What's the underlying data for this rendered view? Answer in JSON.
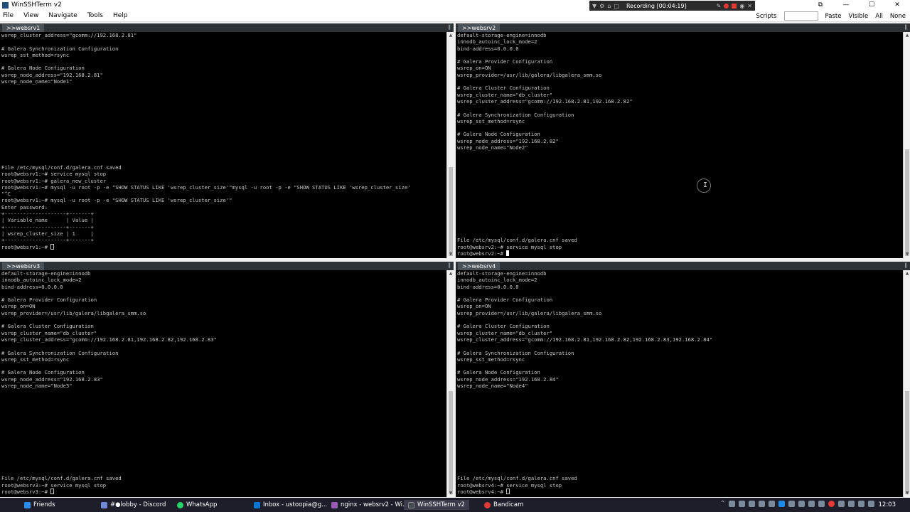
{
  "window": {
    "title": "WinSSHTerm v2",
    "controls": {
      "minimize": "—",
      "maximize": "☐",
      "close": "✕",
      "restore": "⧉"
    }
  },
  "recorder": {
    "label": "Recording [00:04:19]"
  },
  "menu": {
    "items": [
      "File",
      "View",
      "Navigate",
      "Tools",
      "Help"
    ],
    "right": {
      "scripts": "Scripts",
      "paste": "Paste",
      "visible": "Visible",
      "all": "All",
      "none": "None"
    }
  },
  "panes": {
    "p1": {
      "tab": ">>websrv1",
      "lines": [
        "wsrep_cluster_address=\"gcomm://192.168.2.81\"",
        "",
        "# Galera Synchronization Configuration",
        "wsrep_sst_method=rsync",
        "",
        "# Galera Node Configuration",
        "wsrep_node_address=\"192.168.2.81\"",
        "wsrep_node_name=\"Node1\"",
        "",
        "",
        "",
        "",
        "",
        "",
        "",
        "",
        "",
        "",
        "",
        "",
        "File /etc/mysql/conf.d/galera.cnf saved",
        "root@websrv1:~# service mysql stop",
        "root@websrv1:~# galera_new_cluster",
        "root@websrv1:~# mysql -u root -p -e \"SHOW STATUS LIKE 'wsrep_cluster_size'\"mysql -u root -p -e \"SHOW STATUS LIKE 'wsrep_cluster_size'",
        "\"^C",
        "root@websrv1:~# mysql -u root -p -e \"SHOW STATUS LIKE 'wsrep_cluster_size'\"",
        "Enter password:",
        "+--------------------+-------+",
        "| Variable_name      | Value |",
        "+--------------------+-------+",
        "| wsrep_cluster_size | 1     |",
        "+--------------------+-------+"
      ],
      "prompt": "root@websrv1:~# "
    },
    "p2": {
      "tab": ">>websrv2",
      "lines": [
        "default-storage-engine=innodb",
        "innodb_autoinc_lock_mode=2",
        "bind-address=0.0.0.0",
        "",
        "# Galera Provider Configuration",
        "wsrep_on=ON",
        "wsrep_provider=/usr/lib/galera/libgalera_smm.so",
        "",
        "# Galera Cluster Configuration",
        "wsrep_cluster_name=\"db_cluster\"",
        "wsrep_cluster_address=\"gcomm://192.168.2.81,192.168.2.82\"",
        "",
        "# Galera Synchronization Configuration",
        "wsrep_sst_method=rsync",
        "",
        "# Galera Node Configuration",
        "wsrep_node_address=\"192.168.2.82\"",
        "wsrep_node_name=\"Node2\"",
        "",
        "",
        "",
        "",
        "",
        "",
        "",
        "",
        "",
        "",
        "",
        "",
        "",
        "File /etc/mysql/conf.d/galera.cnf saved",
        "root@websrv2:~# service mysql stop"
      ],
      "prompt": "root@websrv2:~# "
    },
    "p3": {
      "tab": ">>websrv3",
      "lines": [
        "default-storage-engine=innodb",
        "innodb_autoinc_lock_mode=2",
        "bind-address=0.0.0.0",
        "",
        "# Galera Provider Configuration",
        "wsrep_on=ON",
        "wsrep_provider=/usr/lib/galera/libgalera_smm.so",
        "",
        "# Galera Cluster Configuration",
        "wsrep_cluster_name=\"db_cluster\"",
        "wsrep_cluster_address=\"gcomm://192.168.2.81,192.168.2.82,192.168.2.83\"",
        "",
        "# Galera Synchronization Configuration",
        "wsrep_sst_method=rsync",
        "",
        "# Galera Node Configuration",
        "wsrep_node_address=\"192.168.2.83\"",
        "wsrep_node_name=\"Node3\"",
        "",
        "",
        "",
        "",
        "",
        "",
        "",
        "",
        "",
        "",
        "",
        "",
        "",
        "File /etc/mysql/conf.d/galera.cnf saved",
        "root@websrv3:~# service mysql stop"
      ],
      "prompt": "root@websrv3:~# "
    },
    "p4": {
      "tab": ">>websrv4",
      "lines": [
        "default-storage-engine=innodb",
        "innodb_autoinc_lock_mode=2",
        "bind-address=0.0.0.0",
        "",
        "# Galera Provider Configuration",
        "wsrep_on=ON",
        "wsrep_provider=/usr/lib/galera/libgalera_smm.so",
        "",
        "# Galera Cluster Configuration",
        "wsrep_cluster_name=\"db_cluster\"",
        "wsrep_cluster_address=\"gcomm://192.168.2.81,192.168.2.82,192.168.2.83,192.168.2.84\"",
        "",
        "# Galera Synchronization Configuration",
        "wsrep_sst_method=rsync",
        "",
        "# Galera Node Configuration",
        "wsrep_node_address=\"192.168.2.84\"",
        "wsrep_node_name=\"Node4\"",
        "",
        "",
        "",
        "",
        "",
        "",
        "",
        "",
        "",
        "",
        "",
        "",
        "",
        "File /etc/mysql/conf.d/galera.cnf saved",
        "root@websrv4:~# service mysql stop"
      ],
      "prompt": "root@websrv4:~# "
    }
  },
  "taskbar": {
    "items": [
      {
        "label": "Friends",
        "icon": "friends-icon",
        "color": "#2d8cf0"
      },
      {
        "label": "#●lobby - Discord",
        "icon": "discord-icon",
        "color": "#7289da"
      },
      {
        "label": "WhatsApp",
        "icon": "whatsapp-icon",
        "color": "#25d366"
      },
      {
        "label": "Inbox - ustoopia@g...",
        "icon": "outlook-icon",
        "color": "#0078d4"
      },
      {
        "label": "nginx - websrv2 - Wi...",
        "icon": "browser-icon",
        "color": "#9b59b6"
      },
      {
        "label": "WinSSHTerm v2",
        "icon": "terminal-icon",
        "color": "#444a52"
      },
      {
        "label": "Bandicam",
        "icon": "bandicam-icon",
        "color": "#e53935"
      }
    ],
    "clock": "12:03"
  },
  "mouse": {
    "glyph": "I"
  }
}
